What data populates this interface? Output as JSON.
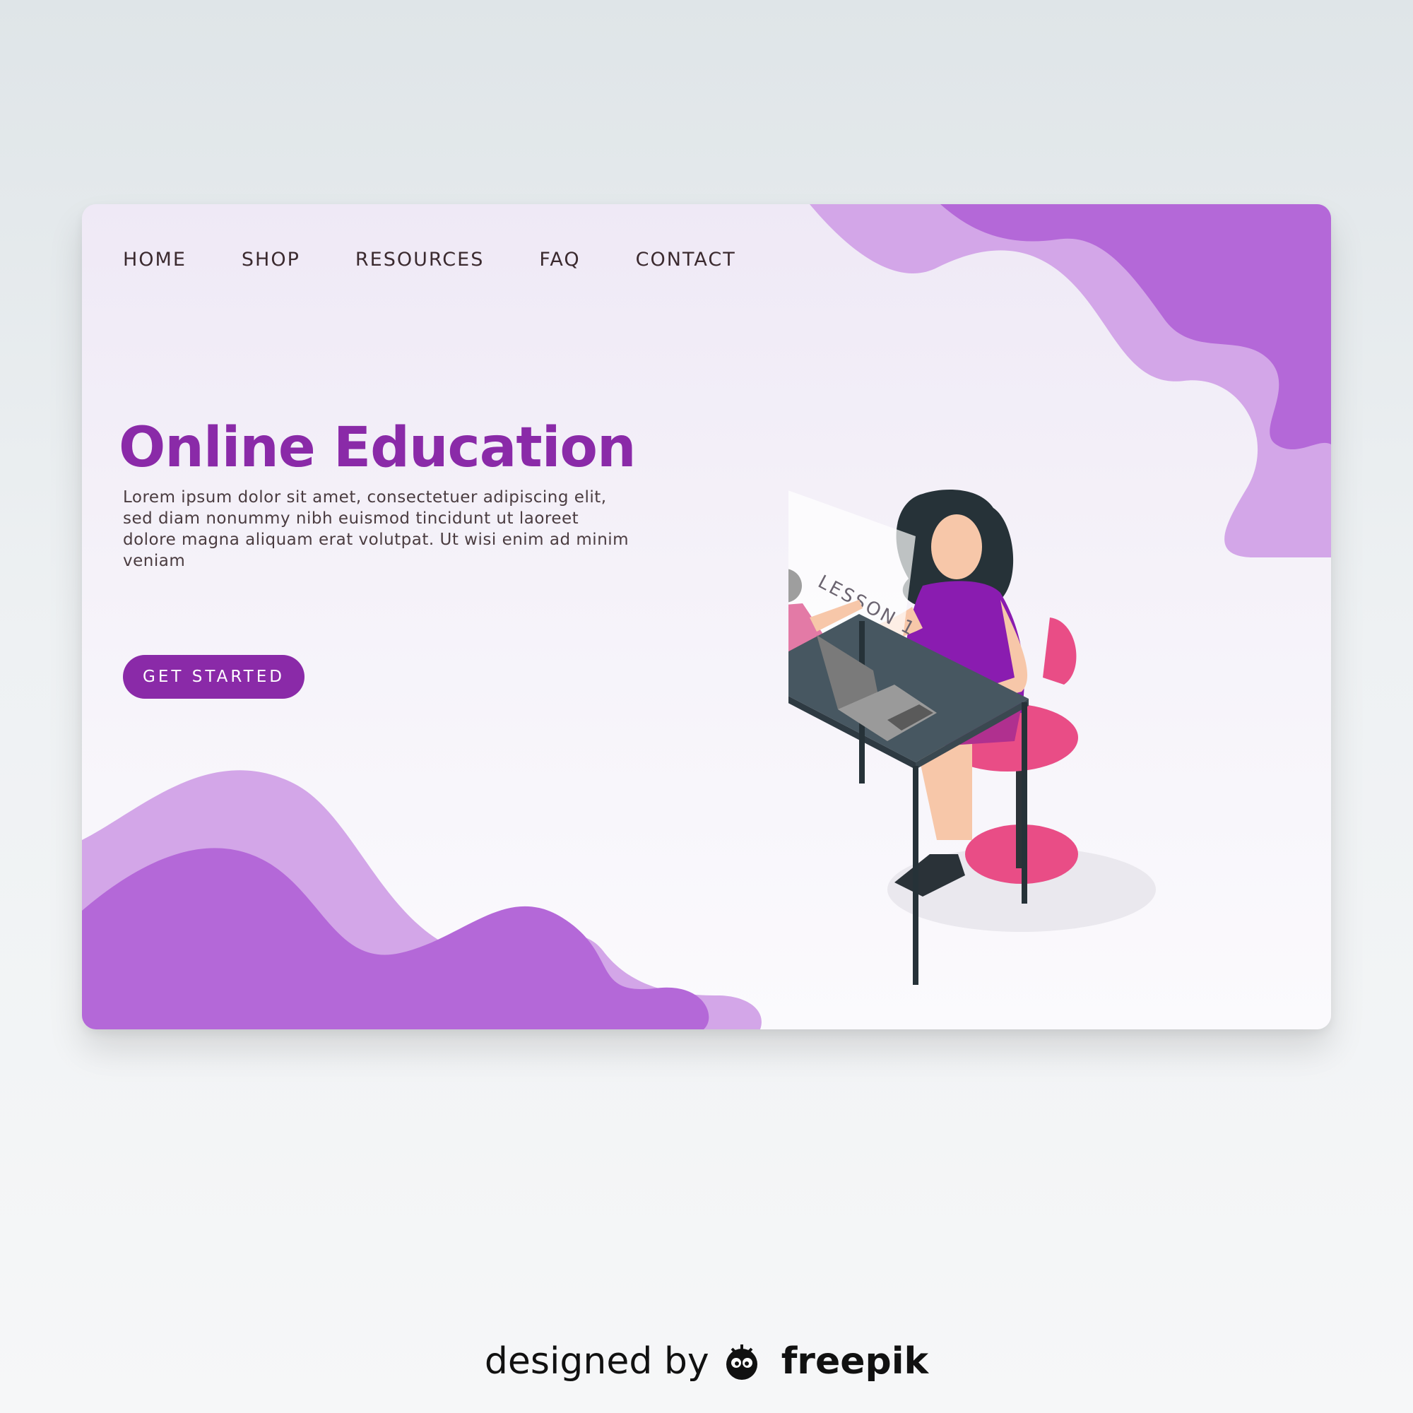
{
  "nav": {
    "items": [
      {
        "label": "HOME"
      },
      {
        "label": "SHOP"
      },
      {
        "label": "RESOURCES"
      },
      {
        "label": "FAQ"
      },
      {
        "label": "CONTACT"
      }
    ]
  },
  "hero": {
    "title": "Online Education",
    "body": "Lorem ipsum dolor sit amet, consectetuer adipiscing elit, sed diam nonummy nibh euismod tincidunt ut laoreet dolore magna aliquam erat volutpat. Ut wisi enim ad minim veniam",
    "cta_label": "GET STARTED"
  },
  "illustration": {
    "screen_text": "LESSON 1"
  },
  "credit": {
    "prefix": "designed by",
    "brand": "freepik",
    "icon": "freepik-logo-icon"
  },
  "colors": {
    "accent": "#8a2aa8",
    "blob_dark": "#b468d8",
    "blob_light": "#d3a6e8",
    "desk": "#475761",
    "chair": "#e94d86",
    "shirt": "#8a1cb0"
  }
}
